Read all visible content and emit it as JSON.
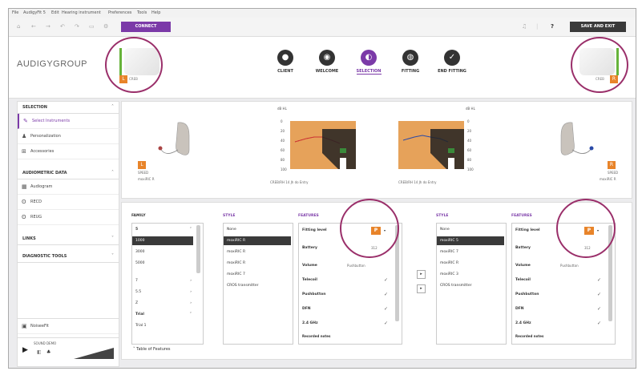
{
  "menu": [
    "File",
    "AudigyFit 5",
    "Edit",
    "Hearing instrument",
    "Preferences",
    "Tools",
    "Help"
  ],
  "toolbar": {
    "connect_label": "CONNECT",
    "save_label": "SAVE AND EXIT"
  },
  "logo_text": "AUDIGYGROUP",
  "steps": [
    {
      "label": "CLIENT",
      "icon": "person-icon"
    },
    {
      "label": "WELCOME",
      "icon": "globe-icon"
    },
    {
      "label": "SELECTION",
      "icon": "selection-icon"
    },
    {
      "label": "FITTING",
      "icon": "fitting-icon"
    },
    {
      "label": "END FITTING",
      "icon": "check-icon"
    }
  ],
  "left_ear": {
    "badge": "L",
    "label": "CREB"
  },
  "right_ear": {
    "badge": "R",
    "label": "CREB"
  },
  "sidebar": {
    "selection_title": "SELECTION",
    "items": [
      {
        "label": "Select Instruments",
        "icon": "instrument-icon"
      },
      {
        "label": "Personalization",
        "icon": "person-icon"
      },
      {
        "label": "Accessories",
        "icon": "accessory-icon"
      }
    ],
    "audiometric_title": "AUDIOMETRIC DATA",
    "audio_items": [
      {
        "label": "Audiogram",
        "icon": "audiogram-icon"
      },
      {
        "label": "RECD",
        "icon": "ear-icon"
      },
      {
        "label": "REUG",
        "icon": "ear-icon"
      }
    ],
    "links_title": "LINKS",
    "diagnostic_title": "DIAGNOSTIC TOOLS",
    "footer_item": "NoiseeFit",
    "sound_label": "SOUND DEMO"
  },
  "devices": {
    "left_caption": "moxiRIC R",
    "right_caption": "moxiRIC R",
    "left_badge": "L",
    "right_badge": "R",
    "left_receiver": "SPEED",
    "right_receiver": "SPEED",
    "aud_left_caption": "CREB/RH 14 Jh do Entry",
    "aud_right_caption": "CREB/RH 14 Jh do Entry",
    "db_label": "dB HL",
    "y_ticks": [
      "-10",
      "0",
      "20",
      "40",
      "60",
      "80",
      "100",
      "120"
    ]
  },
  "family": {
    "title": "FAMILY",
    "items": [
      "5",
      "1000",
      "3000",
      "5000",
      "7",
      "5.5",
      "Z",
      "Trial"
    ],
    "sub_item": "Trial 1"
  },
  "style_left": {
    "title": "STYLE",
    "items": [
      "None",
      "moxiRIC R",
      "moxiRIC R",
      "moxiRIC R",
      "moxiRIC 7",
      "CROS transmitter"
    ]
  },
  "features_left": {
    "title": "FEATURES",
    "rows": [
      {
        "label": "Fitting level",
        "value": "P"
      },
      {
        "label": "Battery",
        "value": "312"
      },
      {
        "label": "Volume",
        "value": "Pushbutton"
      },
      {
        "label": "Telecoil",
        "value": ""
      },
      {
        "label": "Pushbutton",
        "value": ""
      },
      {
        "label": "DFN",
        "value": ""
      },
      {
        "label": "2.4 GHz",
        "value": ""
      },
      {
        "label": "Recorded notes",
        "value": ""
      }
    ]
  },
  "style_right": {
    "title": "STYLE",
    "items": [
      "None",
      "moxiRIC 5",
      "moxiRIC 7",
      "moxiRIC R",
      "moxiRIC 3",
      "CROS transmitter"
    ]
  },
  "features_right": {
    "title": "FEATURES",
    "rows": [
      {
        "label": "Fitting level",
        "value": "P"
      },
      {
        "label": "Battery",
        "value": "312"
      },
      {
        "label": "Volume",
        "value": "Pushbutton"
      },
      {
        "label": "Telecoil",
        "value": ""
      },
      {
        "label": "Pushbutton",
        "value": ""
      },
      {
        "label": "DFN",
        "value": ""
      },
      {
        "label": "2.4 GHz",
        "value": ""
      },
      {
        "label": "Recorded notes",
        "value": ""
      }
    ]
  },
  "table_of_features": "Table of Features",
  "colors": {
    "accent": "#7b3aa8",
    "orange": "#e8842a",
    "green": "#66b33a",
    "highlight": "#9a2f6a"
  }
}
